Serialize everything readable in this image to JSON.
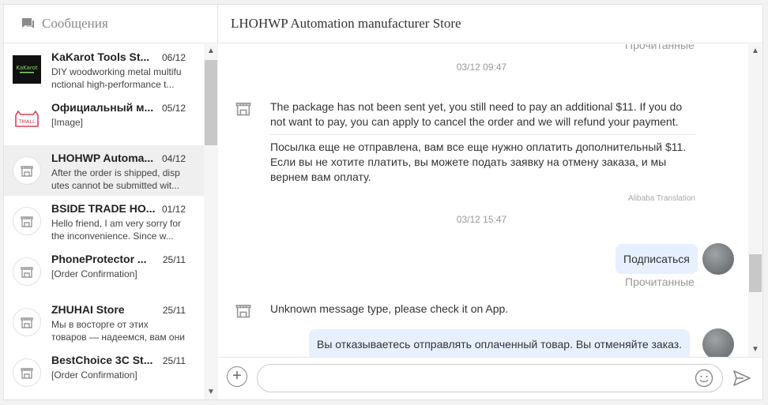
{
  "left": {
    "title": "Сообщения",
    "conversations": [
      {
        "name": "KaKarot Tools St...",
        "date": "06/12",
        "preview": "DIY woodworking metal multifu nctional high-performance t...",
        "avatar": "kakarot-logo"
      },
      {
        "name": "Официальный м...",
        "date": "05/12",
        "preview": "[Image]",
        "avatar": "tmall-logo"
      },
      {
        "name": "LHOHWP Automa...",
        "date": "04/12",
        "preview": "After the order is shipped, disp utes cannot be submitted wit...",
        "avatar": "store-icon"
      },
      {
        "name": "BSIDE TRADE HO...",
        "date": "01/12",
        "preview": "Hello friend, I am very sorry for the inconvenience. Since w...",
        "avatar": "store-icon"
      },
      {
        "name": "PhoneProtector ...",
        "date": "25/11",
        "preview": "[Order Confirmation]",
        "avatar": "store-icon"
      },
      {
        "name": "ZHUHAI Store",
        "date": "25/11",
        "preview": "Мы в восторге от этих товаров — надеемся, вам они тоже...",
        "avatar": "store-icon"
      },
      {
        "name": "BestChoice 3C St...",
        "date": "25/11",
        "preview": "[Order Confirmation]",
        "avatar": "store-icon"
      }
    ],
    "kakarot_logo_text": "KaKarot"
  },
  "chat": {
    "store_name": "LHOHWP Automation manufacturer Store",
    "read_label_top": "Прочитанные",
    "ts1": "03/12 09:47",
    "msg1_en": "The package has not been sent yet, you still need to pay an additional $11. If you do not want to pay, you can apply to cancel the order and we will refund your payment.",
    "msg1_ru": "Посылка еще не отправлена, вам все еще нужно оплатить дополнительный $11. Если вы не хотите платить, вы можете подать заявку на отмену заказа, и мы вернем вам оплату.",
    "translation_tag": "Alibaba Translation",
    "ts2": "03/12 15:47",
    "out1": "Подписаться",
    "read_label_2": "Прочитанные",
    "msg2": "Unknown message type, please check it on App.",
    "out2": "Вы отказываетесь отправлять оплаченный товар. Вы отменяйте заказ."
  },
  "colors": {
    "bubble": "#e6f0ff",
    "active_row": "#efefef",
    "muted_text": "#999999"
  }
}
